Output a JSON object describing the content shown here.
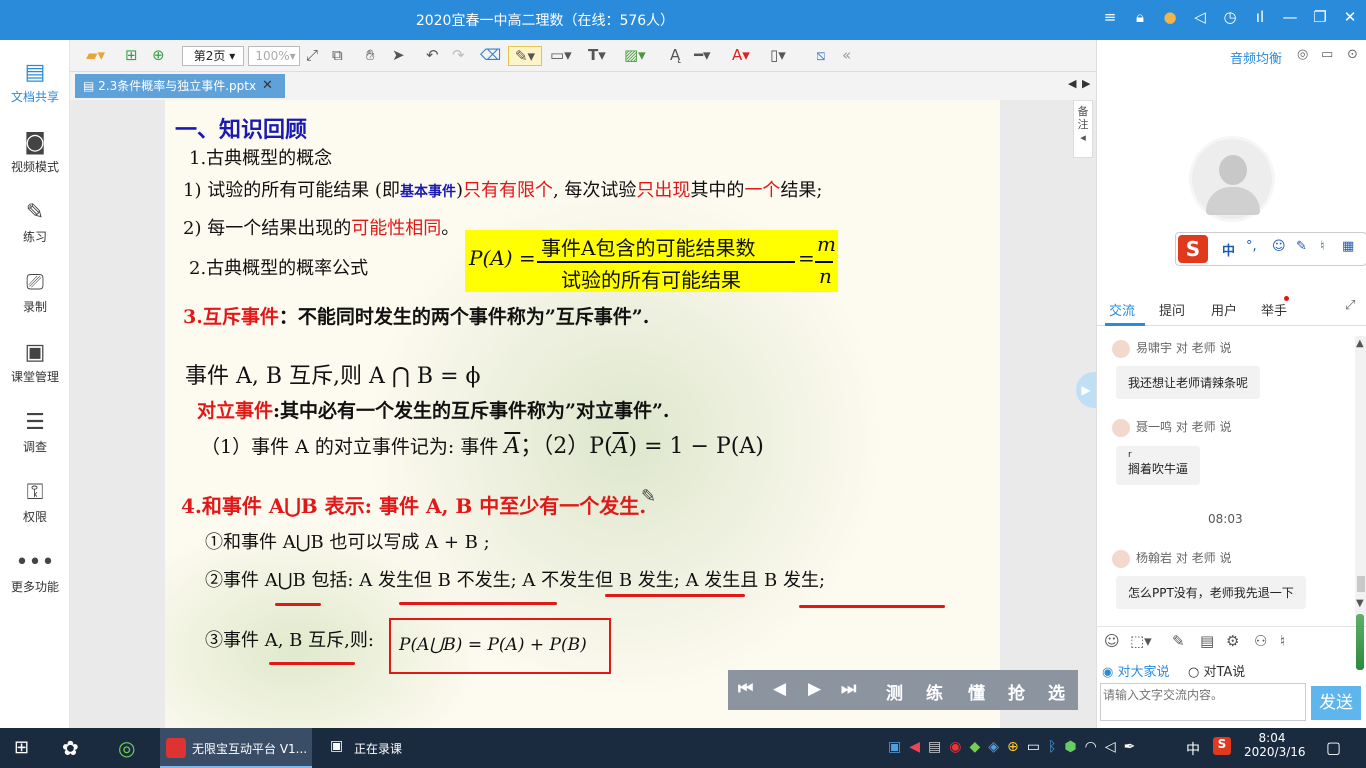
{
  "window": {
    "title": "2020宜春一中高二理数（在线：576人）"
  },
  "left_nav": [
    {
      "label": "文档共享",
      "icon": "document-share-icon"
    },
    {
      "label": "视频模式",
      "icon": "video-mode-icon"
    },
    {
      "label": "练习",
      "icon": "exercise-icon"
    },
    {
      "label": "录制",
      "icon": "record-icon"
    },
    {
      "label": "课堂管理",
      "icon": "class-manage-icon"
    },
    {
      "label": "调查",
      "icon": "survey-icon"
    },
    {
      "label": "权限",
      "icon": "permission-icon"
    },
    {
      "label": "更多功能",
      "icon": "more-icon"
    }
  ],
  "toolbar": {
    "page_select": "第2页",
    "zoom_select": "100%"
  },
  "file_tab": {
    "name": "2.3条件概率与独立事件.pptx"
  },
  "side_tab": "备注",
  "slide": {
    "heading": "一、知识回顾",
    "s1_title": "1.古典概型的概念",
    "l1a": "1) 试验的所有可能结果 (即",
    "l1b": "基本事件",
    "l1c": ")",
    "l1d": "只有有限个",
    "l1e": ", 每次试验",
    "l1f": "只出现",
    "l1g": "其中的",
    "l1h": "一个",
    "l1i": "结果;",
    "l2a": "2) 每一个结果出现的",
    "l2b": "可能性相同",
    "l2c": "。",
    "s2_title": "2.古典概型的概率公式",
    "formula_lhs": "P(A) =",
    "formula_num": "事件A包含的可能结果数",
    "formula_den": "试验的所有可能结果",
    "formula_eq": "=",
    "formula_m": "m",
    "formula_n": "n",
    "s3_a": "3.互斥事件",
    "s3_b": "：不能同时发生的两个事件称为”互斥事件”.",
    "s3_line2": "事件 A, B 互斥,则 A ⋂ B = ϕ",
    "s3_opp_a": "对立事件",
    "s3_opp_b": ":其中必有一个发生的互斥事件称为”对立事件”.",
    "s3_line4a": "（1）事件 A 的对立事件记为: 事件 ",
    "s3_line4b": "A",
    "s3_line4c": "；（2）P(",
    "s3_line4d": "A",
    "s3_line4e": ") = 1 − P(A)",
    "s4_title": "4.和事件 A⋃B 表示: 事件 A, B 中至少有一个发生.",
    "s4_l1": "①和事件 A⋃B 也可以写成 A + B ;",
    "s4_l2": "②事件 A⋃B 包括: A 发生但 B 不发生; A 不发生但 B 发生; A 发生且 B 发生;",
    "s4_l3a": "③事件 A, B 互斥,则:",
    "s4_l3b": "P(A⋃B) = P(A) + P(B)"
  },
  "slide_controls": {
    "labels": [
      "测",
      "练",
      "懂",
      "抢",
      "选"
    ]
  },
  "right": {
    "audio_balance": "音频均衡",
    "ime": {
      "lang": "中"
    },
    "tabs": [
      "交流",
      "提问",
      "用户",
      "举手"
    ],
    "messages": [
      {
        "sender": "易啸宇 对 老师 说",
        "text": "我还想让老师请辣条呢"
      },
      {
        "sender": "聂一鸣 对 老师 说",
        "text_top": "r",
        "text": "搁着吹牛逼"
      },
      {
        "time": "08:03"
      },
      {
        "sender": "杨翰岩 对 老师 说",
        "text": "怎么PPT没有，老师我先退一下"
      }
    ],
    "radio_all": "对大家说",
    "radio_ta": "对TA说",
    "input_placeholder": "请输入文字交流内容。",
    "send": "发送"
  },
  "taskbar": {
    "app1": "无限宝互动平台 V1...",
    "app2": "正在录课",
    "ime": "中",
    "time": "8:04",
    "date": "2020/3/16"
  }
}
